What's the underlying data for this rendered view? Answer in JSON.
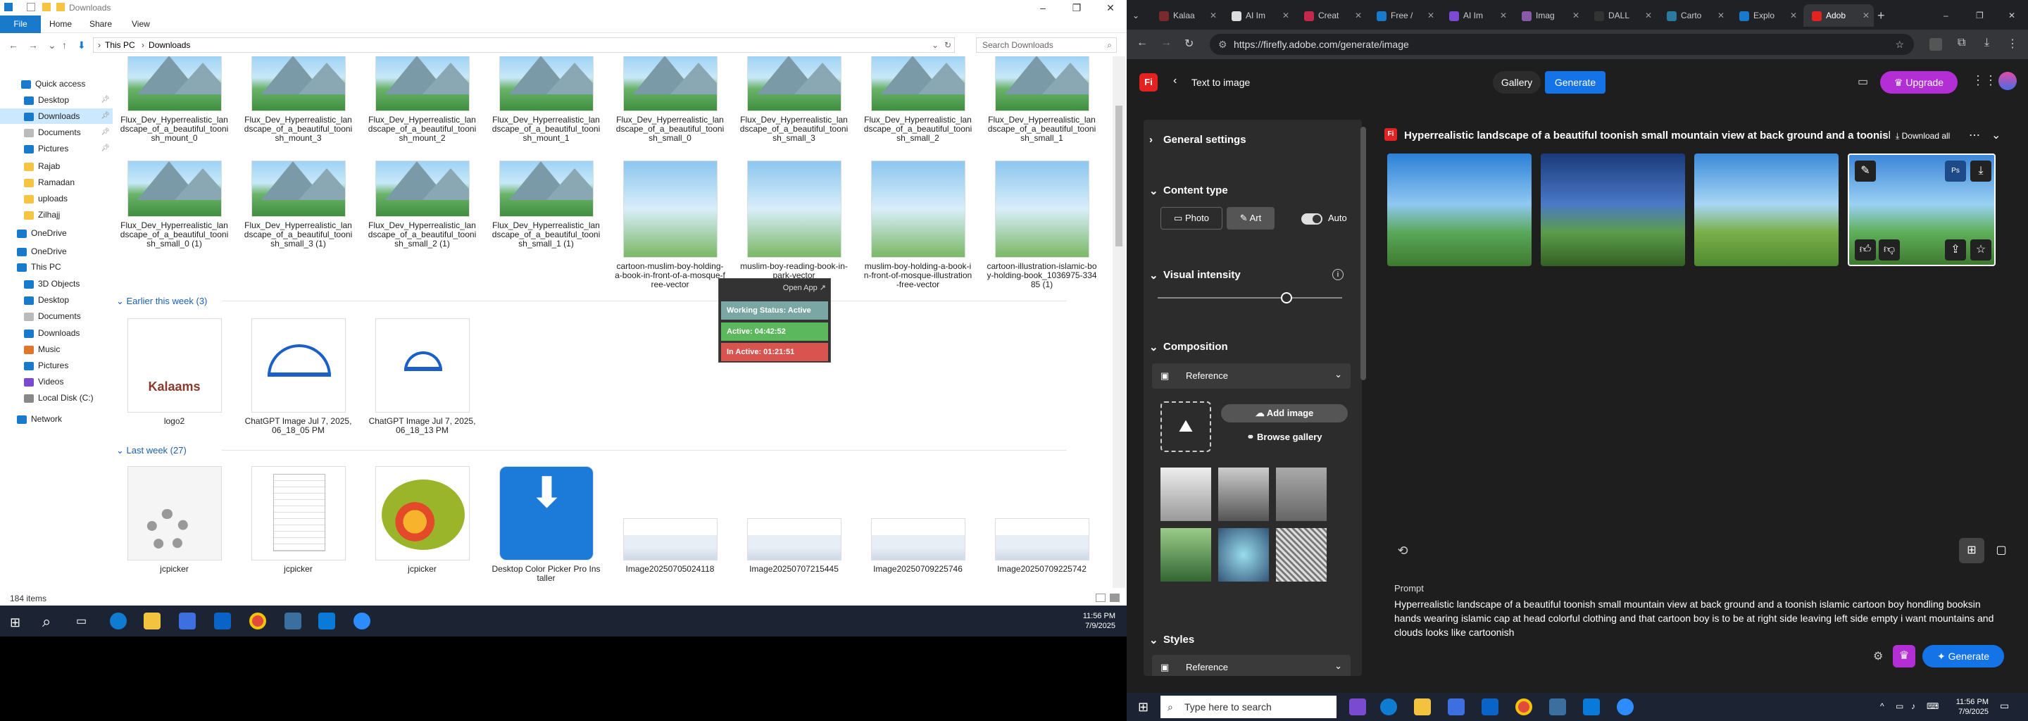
{
  "explorer": {
    "title": "Downloads",
    "ribbon": [
      "File",
      "Home",
      "Share",
      "View"
    ],
    "breadcrumb": [
      "This PC",
      "Downloads"
    ],
    "search_placeholder": "Search Downloads",
    "sidebar": [
      {
        "label": "Quick access",
        "sel": false
      },
      {
        "label": "Desktop",
        "sel": false
      },
      {
        "label": "Downloads",
        "sel": true
      },
      {
        "label": "Documents",
        "sel": false
      },
      {
        "label": "Pictures",
        "sel": false
      },
      {
        "label": "Rajab",
        "sel": false
      },
      {
        "label": "Ramadan",
        "sel": false
      },
      {
        "label": "uploads",
        "sel": false
      },
      {
        "label": "Zilhajj",
        "sel": false
      },
      {
        "label": "OneDrive",
        "sel": false
      },
      {
        "label": "OneDrive",
        "sel": false
      },
      {
        "label": "This PC",
        "sel": false
      },
      {
        "label": "3D Objects",
        "sel": false
      },
      {
        "label": "Desktop",
        "sel": false
      },
      {
        "label": "Documents",
        "sel": false
      },
      {
        "label": "Downloads",
        "sel": false
      },
      {
        "label": "Music",
        "sel": false
      },
      {
        "label": "Pictures",
        "sel": false
      },
      {
        "label": "Videos",
        "sel": false
      },
      {
        "label": "Local Disk (C:)",
        "sel": false
      },
      {
        "label": "Network",
        "sel": false
      }
    ],
    "row1": [
      "Flux_Dev_Hyperrealistic_landscape_of_a_beautiful_toonish_mount_0",
      "Flux_Dev_Hyperrealistic_landscape_of_a_beautiful_toonish_mount_3",
      "Flux_Dev_Hyperrealistic_landscape_of_a_beautiful_toonish_mount_2",
      "Flux_Dev_Hyperrealistic_landscape_of_a_beautiful_toonish_mount_1",
      "Flux_Dev_Hyperrealistic_landscape_of_a_beautiful_toonish_small_0",
      "Flux_Dev_Hyperrealistic_landscape_of_a_beautiful_toonish_small_3",
      "Flux_Dev_Hyperrealistic_landscape_of_a_beautiful_toonish_small_2",
      "Flux_Dev_Hyperrealistic_landscape_of_a_beautiful_toonish_small_1"
    ],
    "row2": [
      "Flux_Dev_Hyperrealistic_landscape_of_a_beautiful_toonish_small_0 (1)",
      "Flux_Dev_Hyperrealistic_landscape_of_a_beautiful_toonish_small_3 (1)",
      "Flux_Dev_Hyperrealistic_landscape_of_a_beautiful_toonish_small_2 (1)",
      "Flux_Dev_Hyperrealistic_landscape_of_a_beautiful_toonish_small_1 (1)",
      "cartoon-muslim-boy-holding-a-book-in-front-of-a-mosque-free-vector",
      "muslim-boy-reading-book-in-park-vector",
      "muslim-boy-holding-a-book-in-front-of-mosque-illustration-free-vector",
      "cartoon-illustration-islamic-boy-holding-book_1036975-33485 (1)"
    ],
    "group_week": "Earlier this week (3)",
    "week": [
      "logo2",
      "ChatGPT Image Jul 7, 2025, 06_18_05 PM",
      "ChatGPT Image Jul 7, 2025, 06_18_13 PM"
    ],
    "logo_text": "Kalaams",
    "group_last": "Last week (27)",
    "last": [
      "jcpicker",
      "jcpicker",
      "jcpicker",
      "Desktop Color Picker Pro Installer",
      "Image20250705024118",
      "Image20250707215445",
      "Image20250709225746",
      "Image20250709225742"
    ],
    "status": "184 items"
  },
  "popup": {
    "open": "Open App ↗",
    "working": "Working Status: Active",
    "active": "Active: 04:42:52",
    "inactive": "In Active: 01:21:51"
  },
  "browser": {
    "tabs": [
      "Kalaa",
      "AI Im",
      "Creat",
      "Free /",
      "AI Im",
      "Imag",
      "DALL",
      "Carto",
      "Explo",
      "Adob"
    ],
    "url": "https://firefly.adobe.com/generate/image",
    "back_label": "Text to image",
    "gallery": "Gallery",
    "generate_top": "Generate",
    "upgrade": "Upgrade",
    "general_settings": "General settings",
    "content_type": "Content type",
    "photo": "Photo",
    "art": "Art",
    "auto": "Auto",
    "visual_intensity": "Visual intensity",
    "visual_intensity_value": 0.7,
    "composition": "Composition",
    "reference": "Reference",
    "add_image": "Add image",
    "browse_gallery": "Browse gallery",
    "styles": "Styles",
    "styles_reference": "Reference",
    "result_title": "Hyperrealistic landscape of a beautiful toonish small mountain view at back ground and a toonish isla",
    "download_all": "Download all",
    "prompt_label": "Prompt",
    "prompt": "Hyperrealistic landscape of a beautiful toonish small mountain view at back ground and a toonish islamic cartoon boy hondling booksin hands wearing islamic cap at head  colorful clothing and that cartoon boy is to be at right side leaving left side empty i want mountains and clouds looks like cartoonish",
    "generate_bottom": "Generate"
  },
  "taskbar_left": {
    "time": "11:56 PM",
    "date": "7/9/2025"
  },
  "taskbar_right": {
    "search": "Type here to search",
    "time": "11:56 PM",
    "date": "7/9/2025"
  }
}
